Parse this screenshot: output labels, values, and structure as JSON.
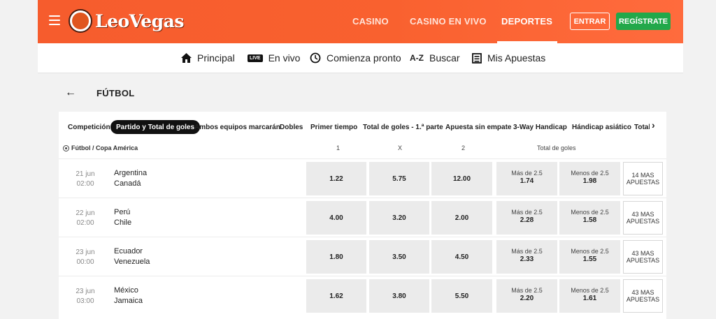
{
  "header": {
    "logo_text": "LeoVegas",
    "nav": [
      {
        "label": "CASINO",
        "active": false
      },
      {
        "label": "CASINO EN VIVO",
        "active": false
      },
      {
        "label": "DEPORTES",
        "active": true
      }
    ],
    "login_label": "ENTRAR",
    "register_label": "REGÍSTRATE",
    "colors": {
      "brand": "#f65c2d",
      "register": "#22a84a"
    }
  },
  "subnav": {
    "items": [
      {
        "label": "Principal",
        "icon": "home-icon"
      },
      {
        "label": "En vivo",
        "icon": "live-icon",
        "badge": "LIVE"
      },
      {
        "label": "Comienza pronto",
        "icon": "clock-icon"
      },
      {
        "label": "Buscar",
        "icon": "az-search-icon",
        "badge": "A-Z"
      },
      {
        "label": "Mis Apuestas",
        "icon": "betslip-icon"
      }
    ]
  },
  "section": {
    "title": "FÚTBOL"
  },
  "tabs": [
    {
      "label": "Competición",
      "active": false
    },
    {
      "label": "Partido y Total de goles",
      "active": true
    },
    {
      "label": "Ambos equipos marcarán",
      "active": false
    },
    {
      "label": "Dobles",
      "active": false
    },
    {
      "label": "Primer tiempo",
      "active": false
    },
    {
      "label": "Total de goles - 1.ª parte",
      "active": false
    },
    {
      "label": "Apuesta sin empate",
      "active": false
    },
    {
      "label": "3-Way Handicap",
      "active": false
    },
    {
      "label": "Hándicap asiático",
      "active": false
    },
    {
      "label": "Total d",
      "active": false
    }
  ],
  "table": {
    "competition": "Fútbol / Copa América",
    "columns": {
      "home": "1",
      "draw": "X",
      "away": "2",
      "totals": "Total de goles"
    },
    "matches": [
      {
        "day": "21 jun",
        "time": "02:00",
        "home": "Argentina",
        "away": "Canadá",
        "odds": [
          "1.22",
          "5.75",
          "12.00"
        ],
        "over_label": "Más de  2.5",
        "over": "1.74",
        "under_label": "Menos de  2.5",
        "under": "1.98",
        "more": "14 MAS APUESTAS"
      },
      {
        "day": "22 jun",
        "time": "02:00",
        "home": "Perú",
        "away": "Chile",
        "odds": [
          "4.00",
          "3.20",
          "2.00"
        ],
        "over_label": "Más de  2.5",
        "over": "2.28",
        "under_label": "Menos de  2.5",
        "under": "1.58",
        "more": "43 MAS APUESTAS"
      },
      {
        "day": "23 jun",
        "time": "00:00",
        "home": "Ecuador",
        "away": "Venezuela",
        "odds": [
          "1.80",
          "3.50",
          "4.50"
        ],
        "over_label": "Más de  2.5",
        "over": "2.33",
        "under_label": "Menos de  2.5",
        "under": "1.55",
        "more": "43 MAS APUESTAS"
      },
      {
        "day": "23 jun",
        "time": "03:00",
        "home": "México",
        "away": "Jamaica",
        "odds": [
          "1.62",
          "3.80",
          "5.50"
        ],
        "over_label": "Más de  2.5",
        "over": "2.20",
        "under_label": "Menos de  2.5",
        "under": "1.61",
        "more": "43 MAS APUESTAS"
      }
    ]
  }
}
